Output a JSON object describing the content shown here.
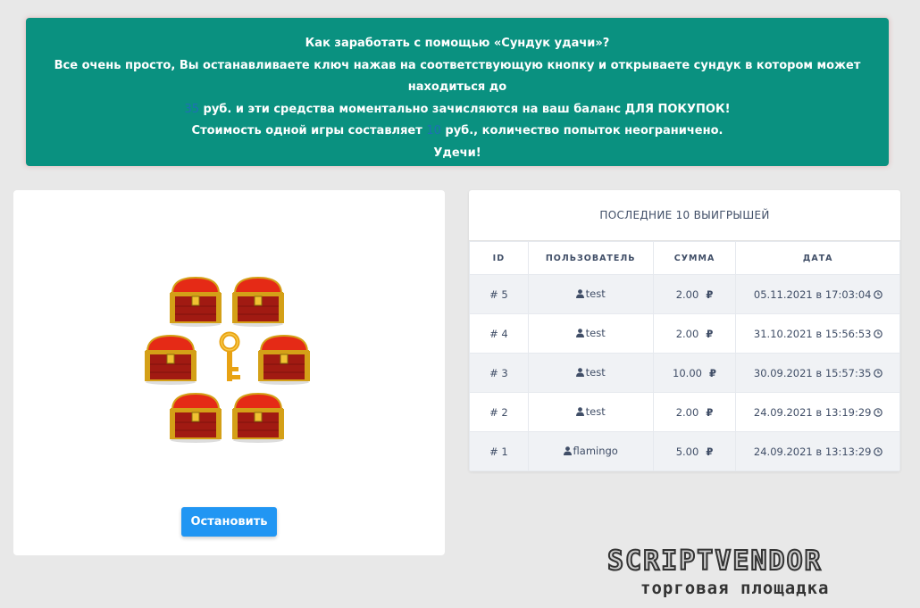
{
  "banner": {
    "line1": "Как заработать с помощью «Сундук удачи»?",
    "line2": "Все очень просто, Вы останавливаете ключ нажав на соответствующую кнопку и открываете сундук в котором может находиться до",
    "max_amount": "35",
    "line3_rest": "руб. и эти средства моментально зачисляются на ваш баланс ДЛЯ ПОКУПОК!",
    "line4_pre": "Стоимость одной игры составляет",
    "game_cost": "10",
    "line4_post": "руб., количество попыток неограничено.",
    "line5": "Удечи!"
  },
  "game": {
    "chest_icon": "treasure-chest-icon",
    "key_icon": "key-icon",
    "stop_button": "Остановить"
  },
  "winners": {
    "title": "ПОСЛЕДНИЕ 10 ВЫИГРЫШЕЙ",
    "columns": [
      "ID",
      "ПОЛЬЗОВАТЕЛЬ",
      "СУММА",
      "ДАТА"
    ],
    "currency": "₽",
    "rows": [
      {
        "id": "# 5",
        "user": "test",
        "amount": "2.00",
        "date": "05.11.2021 в 17:03:04"
      },
      {
        "id": "# 4",
        "user": "test",
        "amount": "2.00",
        "date": "31.10.2021 в 15:56:53"
      },
      {
        "id": "# 3",
        "user": "test",
        "amount": "10.00",
        "date": "30.09.2021 в 15:57:35"
      },
      {
        "id": "# 2",
        "user": "test",
        "amount": "2.00",
        "date": "24.09.2021 в 13:19:29"
      },
      {
        "id": "# 1",
        "user": "flamingo",
        "amount": "5.00",
        "date": "24.09.2021 в 13:13:29"
      }
    ]
  },
  "watermark": {
    "brand": "SCRIPTVENDOR",
    "tagline": "торговая площадка"
  },
  "colors": {
    "banner_bg": "#0a9180",
    "highlight": "#1f6fb5",
    "button": "#2196f3",
    "page_bg": "#e8e8e8"
  }
}
